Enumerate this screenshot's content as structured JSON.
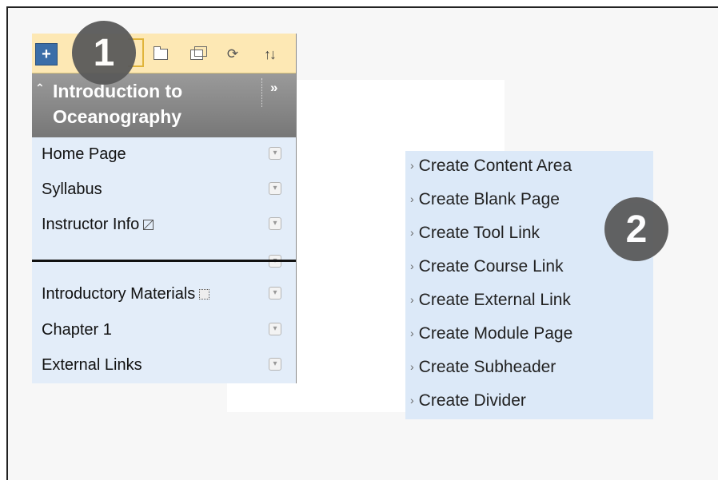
{
  "course_menu": {
    "add_button_label": "+",
    "title": "Introduction to Oceanography",
    "items": [
      {
        "label": "Home Page",
        "icon": ""
      },
      {
        "label": "Syllabus",
        "icon": ""
      },
      {
        "label": "Instructor Info",
        "icon": "hidden-from-students-icon"
      },
      {
        "label": "",
        "icon": ""
      },
      {
        "label": "Introductory Materials",
        "icon": "hidden-area-icon"
      },
      {
        "label": "Chapter 1",
        "icon": ""
      },
      {
        "label": "External Links",
        "icon": ""
      }
    ]
  },
  "flyout_menu": {
    "items": [
      "Create Content Area",
      "Create Blank Page",
      "Create Tool Link",
      "Create Course Link",
      "Create External Link",
      "Create Module Page",
      "Create Subheader",
      "Create Divider"
    ]
  },
  "callouts": {
    "one": "1",
    "two": "2"
  },
  "colors": {
    "toolbar": "#fde8b4",
    "menu_background": "#e3edf9",
    "header": "#888888",
    "flyout_background": "#dce9f8",
    "badge": "#5a5a5a",
    "add_button": "#3b6ea8"
  }
}
